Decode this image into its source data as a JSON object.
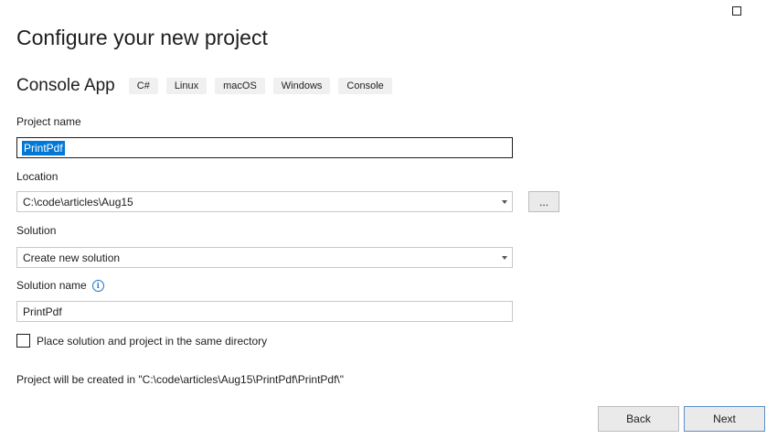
{
  "window": {
    "maximize_icon": "maximize-icon"
  },
  "page": {
    "title": "Configure your new project"
  },
  "template": {
    "name": "Console App",
    "tags": [
      "C#",
      "Linux",
      "macOS",
      "Windows",
      "Console"
    ]
  },
  "project_name": {
    "label": "Project name",
    "value": "PrintPdf"
  },
  "location": {
    "label": "Location",
    "value": "C:\\code\\articles\\Aug15",
    "browse_label": "..."
  },
  "solution": {
    "label": "Solution",
    "value": "Create new solution"
  },
  "solution_name": {
    "label": "Solution name",
    "info_icon": "info-icon",
    "info_glyph": "i",
    "value": "PrintPdf"
  },
  "same_directory": {
    "label": "Place solution and project in the same directory",
    "checked": false
  },
  "created_path": "Project will be created in \"C:\\code\\articles\\Aug15\\PrintPdf\\PrintPdf\\\"",
  "buttons": {
    "back": "Back",
    "next": "Next"
  },
  "colors": {
    "selection": "#0078d7",
    "info_accent": "#1f6fc5",
    "next_border": "#5b8fc9"
  }
}
